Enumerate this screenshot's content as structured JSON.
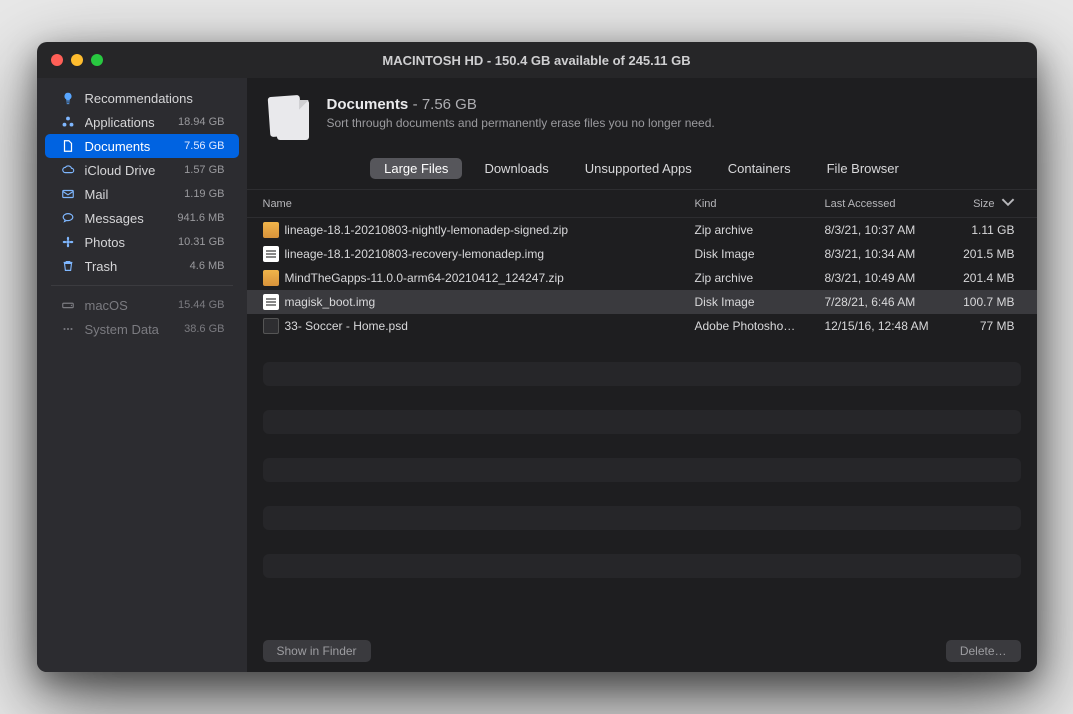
{
  "window_title": "MACINTOSH HD - 150.4 GB available of 245.11 GB",
  "header": {
    "title": "Documents",
    "size": "7.56 GB",
    "subtitle": "Sort through documents and permanently erase files you no longer need."
  },
  "sidebar": {
    "items": [
      {
        "icon": "bulb",
        "label": "Recommendations",
        "size": "",
        "dim": false
      },
      {
        "icon": "apps",
        "label": "Applications",
        "size": "18.94 GB",
        "dim": false
      },
      {
        "icon": "doc",
        "label": "Documents",
        "size": "7.56 GB",
        "dim": false,
        "selected": true
      },
      {
        "icon": "cloud",
        "label": "iCloud Drive",
        "size": "1.57 GB",
        "dim": false
      },
      {
        "icon": "mail",
        "label": "Mail",
        "size": "1.19 GB",
        "dim": false
      },
      {
        "icon": "msg",
        "label": "Messages",
        "size": "941.6 MB",
        "dim": false
      },
      {
        "icon": "photos",
        "label": "Photos",
        "size": "10.31 GB",
        "dim": false
      },
      {
        "icon": "trash",
        "label": "Trash",
        "size": "4.6 MB",
        "dim": false
      }
    ],
    "bottom": [
      {
        "icon": "drive",
        "label": "macOS",
        "size": "15.44 GB"
      },
      {
        "icon": "dots",
        "label": "System Data",
        "size": "38.6 GB"
      }
    ]
  },
  "tabs": [
    "Large Files",
    "Downloads",
    "Unsupported Apps",
    "Containers",
    "File Browser"
  ],
  "active_tab": 0,
  "columns": {
    "name": "Name",
    "kind": "Kind",
    "date": "Last Accessed",
    "size": "Size"
  },
  "files": [
    {
      "icon": "zip",
      "name": "lineage-18.1-20210803-nightly-lemonadep-signed.zip",
      "kind": "Zip archive",
      "date": "8/3/21, 10:37 AM",
      "size": "1.11 GB"
    },
    {
      "icon": "img",
      "name": "lineage-18.1-20210803-recovery-lemonadep.img",
      "kind": "Disk Image",
      "date": "8/3/21, 10:34 AM",
      "size": "201.5 MB"
    },
    {
      "icon": "zip",
      "name": "MindTheGapps-11.0.0-arm64-20210412_124247.zip",
      "kind": "Zip archive",
      "date": "8/3/21, 10:49 AM",
      "size": "201.4 MB"
    },
    {
      "icon": "img",
      "name": "magisk_boot.img",
      "kind": "Disk Image",
      "date": "7/28/21, 6:46 AM",
      "size": "100.7 MB",
      "selected": true
    },
    {
      "icon": "psd",
      "name": "33- Soccer - Home.psd",
      "kind": "Adobe Photosho…",
      "date": "12/15/16, 12:48 AM",
      "size": "77 MB"
    }
  ],
  "footer": {
    "show": "Show in Finder",
    "delete": "Delete…"
  }
}
